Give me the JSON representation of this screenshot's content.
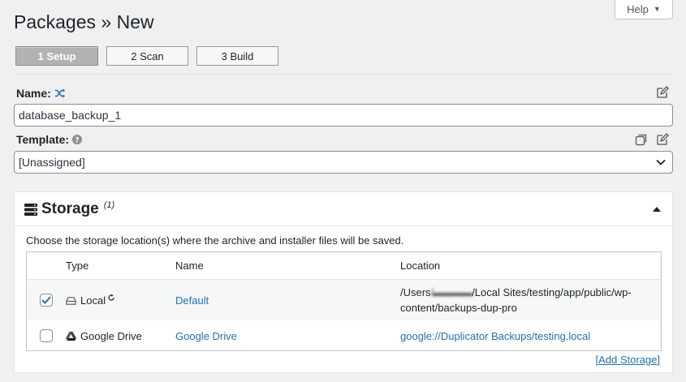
{
  "help": {
    "label": "Help",
    "caret": "▼"
  },
  "page": {
    "title": "Packages » New"
  },
  "steps": [
    {
      "label": "1 Setup",
      "active": true
    },
    {
      "label": "2 Scan"
    },
    {
      "label": "3 Build"
    }
  ],
  "name_field": {
    "label": "Name:",
    "value": "database_backup_1"
  },
  "template_field": {
    "label": "Template:",
    "value": "[Unassigned]"
  },
  "storage": {
    "title": "Storage",
    "count": "(1)",
    "description": "Choose the storage location(s) where the archive and installer files will be saved.",
    "columns": {
      "type": "Type",
      "name": "Name",
      "location": "Location"
    },
    "rows": [
      {
        "checked": true,
        "type": "Local",
        "name": "Default",
        "location_prefix": "/Users",
        "location_redacted": "/▬▬▬▬",
        "location_suffix": "/Local Sites/testing/app/public/wp-content/backups-dup-pro"
      },
      {
        "checked": false,
        "type": "Google Drive",
        "name": "Google Drive",
        "location": "google://Duplicator Backups/testing.local"
      }
    ],
    "add_link": "[Add Storage]"
  },
  "colors": {
    "accent": "#2271b1",
    "background": "#f0f0f1",
    "active_step": "#b2b2b2"
  }
}
